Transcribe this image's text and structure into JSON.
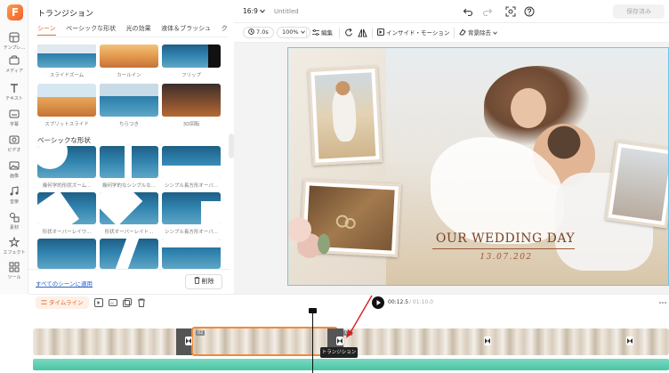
{
  "app": {
    "logo_letter": "F",
    "accent": "#e5652e"
  },
  "rail": {
    "items": [
      {
        "label": "テンプレ...",
        "icon": "template-icon"
      },
      {
        "label": "メディア",
        "icon": "media-icon"
      },
      {
        "label": "テキスト",
        "icon": "text-icon"
      },
      {
        "label": "字幕",
        "icon": "subtitle-icon"
      },
      {
        "label": "ビデオ",
        "icon": "video-icon"
      },
      {
        "label": "画像",
        "icon": "image-icon"
      },
      {
        "label": "音楽",
        "icon": "music-icon"
      },
      {
        "label": "素材",
        "icon": "elements-icon"
      },
      {
        "label": "エフェクト",
        "icon": "effects-icon"
      },
      {
        "label": "ツール",
        "icon": "tools-icon"
      }
    ]
  },
  "panel": {
    "title": "トランジション",
    "tabs": [
      "シーン",
      "ベーシックな形状",
      "光の効果",
      "液体＆ブラッシュ",
      "クリ"
    ],
    "row1_captions": [
      "スライドズーム",
      "カールイン",
      "フリップ"
    ],
    "row2_captions": [
      "スプリットスライド",
      "ちらつき",
      "3D回転"
    ],
    "section_title": "ベーシックな形状",
    "row3_captions": [
      "幾何学的形状ズーム...",
      "幾何学的なシンプルな...",
      "シンプル長方形オーバ..."
    ],
    "row4_captions": [
      "形状オーバーレイワ...",
      "形状オーバーレイト...",
      "シンプル長方形オーバ..."
    ],
    "apply_all": "すべてのシーンに適用",
    "delete": "削除"
  },
  "topbar": {
    "ratio": "16:9",
    "title": "Untitled",
    "export": "保存済み"
  },
  "toolbar": {
    "duration": "7.0s",
    "zoom": "100%",
    "edit": "編集",
    "inside_motion": "インサイド・モーション",
    "bg_remove": "背景除去"
  },
  "canvas": {
    "headline": "OUR WEDDING DAY",
    "date": "13.07.202"
  },
  "timeline": {
    "label": "タイムライン",
    "current_time": "00:12.5",
    "total_time": "/ 01:10.0",
    "clip_labels": [
      "01",
      "02",
      "03"
    ],
    "tooltip": "トランジション"
  }
}
